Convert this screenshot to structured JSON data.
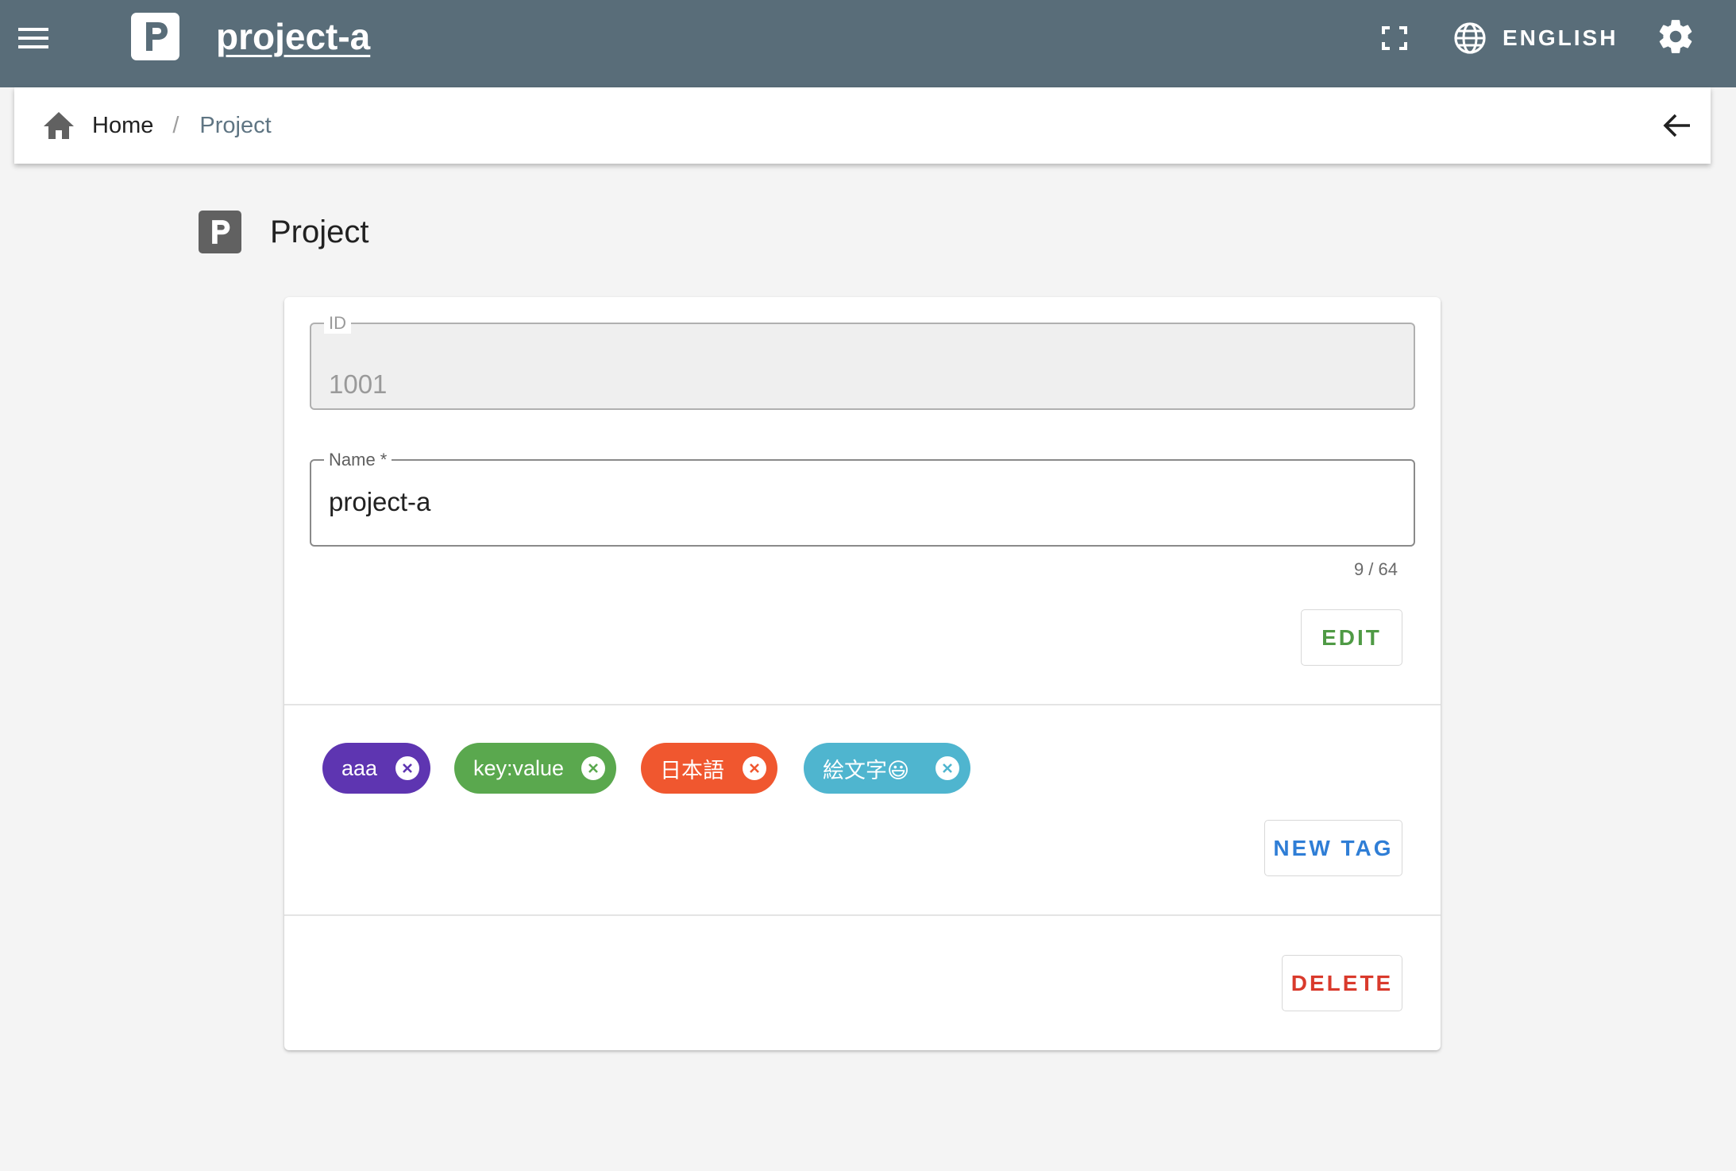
{
  "app": {
    "logo_letter": "P",
    "title": "project-a",
    "language_label": "ENGLISH"
  },
  "breadcrumb": {
    "home": "Home",
    "separator": "/",
    "current": "Project"
  },
  "page": {
    "icon_letter": "P",
    "title": "Project"
  },
  "form": {
    "id_label": "ID",
    "id_value": "1001",
    "name_label": "Name *",
    "name_value": "project-a",
    "name_counter": "9 / 64",
    "edit_label": "EDIT"
  },
  "tags": {
    "items": [
      {
        "label": "aaa",
        "color": "#5e35b1"
      },
      {
        "label": "key:value",
        "color": "#5aa84e"
      },
      {
        "label": "日本語",
        "color": "#f0572f"
      },
      {
        "label": "絵文字😃",
        "color": "#4fb5cf"
      }
    ],
    "new_tag_label": "NEW TAG"
  },
  "actions": {
    "delete_label": "DELETE"
  },
  "colors": {
    "appbar": "#596d79",
    "edit": "#4f9a45",
    "new_tag": "#2f7ed6",
    "delete": "#d93a2c"
  }
}
